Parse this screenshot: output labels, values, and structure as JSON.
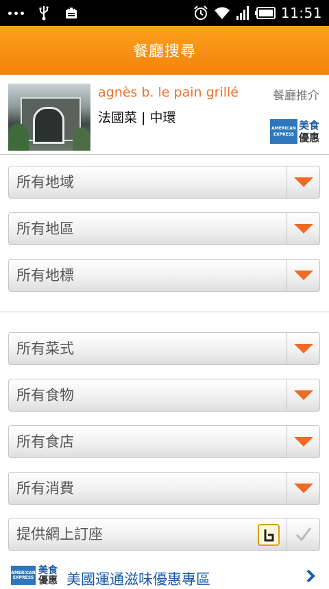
{
  "status_bar": {
    "time": "11:51"
  },
  "header": {
    "title": "餐廳搜尋"
  },
  "featured": {
    "name": "agnès b. le pain grillé",
    "category": "法國菜 | 中環",
    "recommend_label": "餐廳推介",
    "amex_logo_top": "AMERICAN",
    "amex_logo_bottom": "EXPRESS",
    "amex_badge_line1": "美食",
    "amex_badge_line2": "優惠"
  },
  "location_filters": [
    {
      "label": "所有地域"
    },
    {
      "label": "所有地區"
    },
    {
      "label": "所有地標"
    }
  ],
  "food_filters": [
    {
      "label": "所有菜式"
    },
    {
      "label": "所有食物"
    },
    {
      "label": "所有食店"
    },
    {
      "label": "所有消費"
    }
  ],
  "online_booking": {
    "label": "提供網上訂座",
    "checked": false
  },
  "amex_banner": {
    "logo_top": "AMERICAN",
    "logo_bottom": "EXPRESS",
    "mini_line1": "美食",
    "mini_line2": "優惠",
    "text": "美國運通滋味優惠專區"
  },
  "colors": {
    "header_orange": "#f5820a",
    "accent_orange": "#ef6a22",
    "link_blue": "#1a5aa8"
  }
}
